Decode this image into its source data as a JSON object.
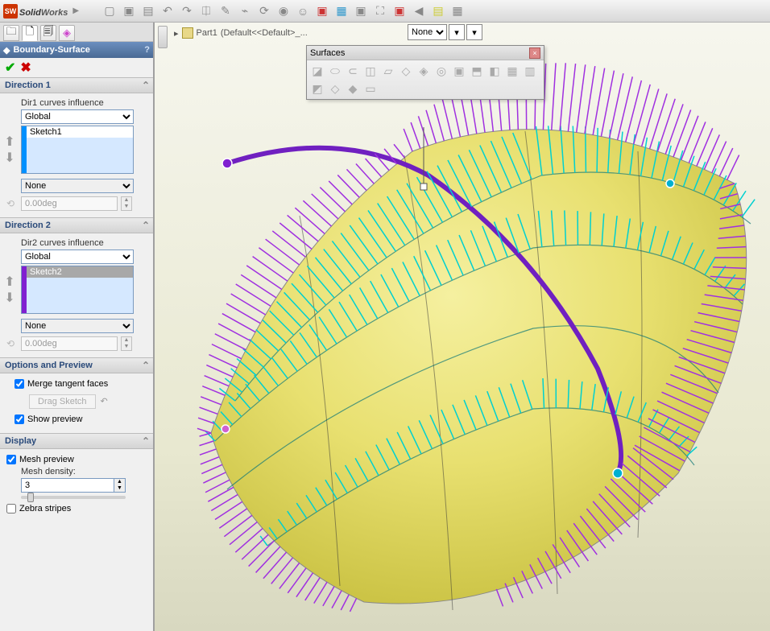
{
  "app": {
    "name": "SolidWorks",
    "name_bold": "Solid",
    "name_ital": "Works"
  },
  "breadcrumb": {
    "part": "Part1",
    "config": "(Default<<Default>_..."
  },
  "top_dropdown": {
    "selected": "None"
  },
  "propmgr": {
    "title": "Boundary-Surface",
    "dir1": {
      "header": "Direction 1",
      "label": "Dir1 curves influence",
      "influence": "Global",
      "sketch": "Sketch1",
      "end_condition": "None",
      "angle": "0.00deg"
    },
    "dir2": {
      "header": "Direction 2",
      "label": "Dir2 curves influence",
      "influence": "Global",
      "sketch": "Sketch2",
      "end_condition": "None",
      "angle": "0.00deg"
    },
    "options": {
      "header": "Options and Preview",
      "merge": "Merge tangent faces",
      "drag": "Drag Sketch",
      "preview": "Show preview"
    },
    "display": {
      "header": "Display",
      "mesh_preview": "Mesh preview",
      "mesh_density_label": "Mesh density:",
      "mesh_density": "3",
      "zebra": "Zebra stripes"
    }
  },
  "surfaces_toolbar": {
    "title": "Surfaces"
  },
  "colors": {
    "surface": "#e8e070",
    "surface_shade": "#d4cc50",
    "surface_light": "#f5f0a0",
    "comb_dir1": "#00d0d0",
    "comb_dir2": "#a030e0",
    "curve_sel": "#7020c0",
    "curve_edge": "#107878",
    "node": "#d060d0",
    "node_end": "#00b0d0"
  }
}
